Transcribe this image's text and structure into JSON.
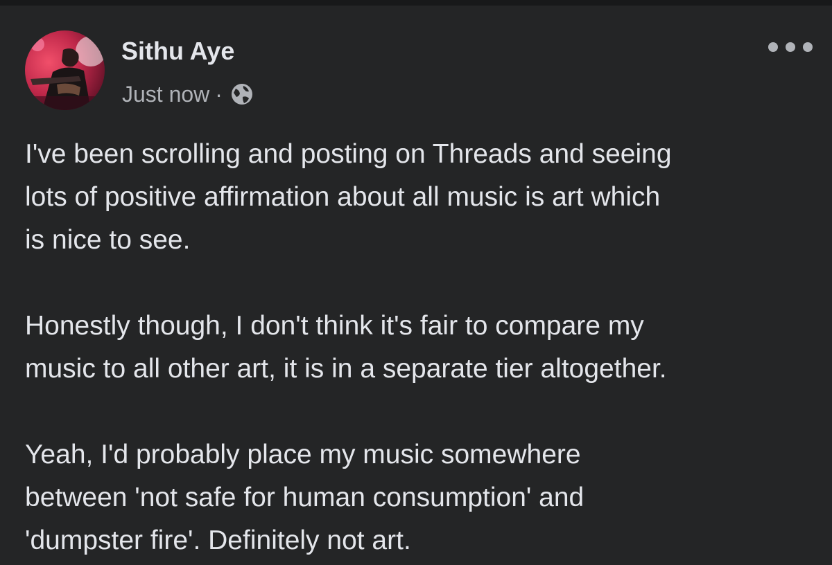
{
  "post": {
    "author": "Sithu Aye",
    "timestamp": "Just now",
    "separator": "·",
    "privacy_icon": "globe-icon",
    "more_icon": "more-options-icon",
    "paragraphs": [
      "I've been scrolling and posting on Threads and seeing\nlots of positive affirmation about all music is art which\nis nice to see.",
      "Honestly though, I don't think it's fair to compare my\nmusic to all other art, it is in a separate tier altogether.",
      "Yeah, I'd probably place my music somewhere\nbetween 'not safe for human consumption' and\n'dumpster fire'. Definitely not art."
    ]
  },
  "colors": {
    "background": "#242526",
    "primary_text": "#e4e6eb",
    "secondary_text": "#b0b3b8"
  }
}
